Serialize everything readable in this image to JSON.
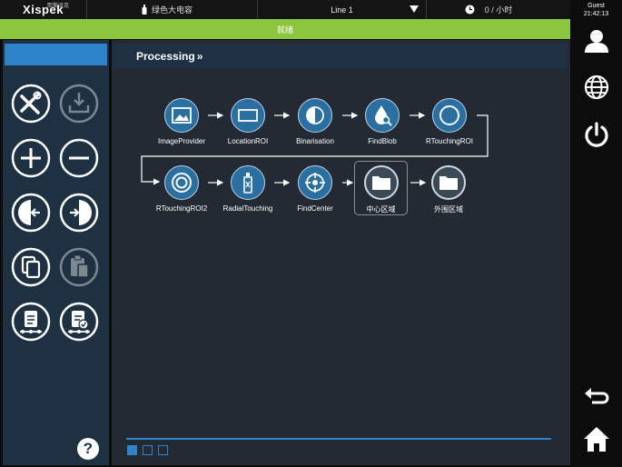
{
  "topbar": {
    "logo_text": "Xispek",
    "logo_sup": "熙斯派克",
    "product": "绿色大电容",
    "line": "Line 1",
    "rate": "0 / 小时"
  },
  "status": {
    "text": "就绪",
    "color": "#8cc63f"
  },
  "user": {
    "name": "Guest",
    "time": "21:42:13"
  },
  "main": {
    "title": "Processing",
    "title_suffix": "»"
  },
  "nodes": [
    {
      "label": "ImageProvider",
      "icon": "image-icon"
    },
    {
      "label": "LocationROI",
      "icon": "rectangle-icon"
    },
    {
      "label": "Binarisation",
      "icon": "contrast-icon"
    },
    {
      "label": "FindBlob",
      "icon": "drop-search-icon"
    },
    {
      "label": "RTouchingROI",
      "icon": "circle-icon"
    },
    {
      "label": "RTouchingROI2",
      "icon": "double-circle-icon"
    },
    {
      "label": "RadialTouching",
      "icon": "bottle-icon"
    },
    {
      "label": "FindCenter",
      "icon": "crosshair-icon"
    },
    {
      "label": "中心区域",
      "icon": "folder-icon"
    },
    {
      "label": "外围区域",
      "icon": "folder-icon"
    }
  ],
  "tools": [
    "tools-icon",
    "import-icon",
    "add-icon",
    "remove-icon",
    "move-left-icon",
    "move-right-icon",
    "copy-icon",
    "paste-icon",
    "clipboard-flow-icon",
    "clipboard-check-icon"
  ],
  "pager": {
    "pages": 3,
    "active": 1
  },
  "colors": {
    "accent": "#2d84c8",
    "node": "#2a6fa1",
    "panel": "#1d3143",
    "canvas": "#232a33"
  }
}
